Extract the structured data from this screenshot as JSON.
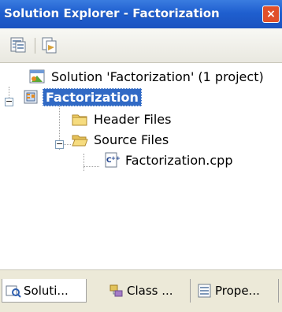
{
  "window": {
    "title": "Solution Explorer - Factorization"
  },
  "toolbar": {
    "buttons": [
      {
        "icon": "properties-icon"
      },
      {
        "icon": "show-all-files-icon"
      }
    ]
  },
  "tree": {
    "solution": "Solution 'Factorization' (1 project)",
    "project": "Factorization",
    "header_files": "Header Files",
    "source_files": "Source Files",
    "cpp_file": "Factorization.cpp",
    "expander_minus": "−"
  },
  "tabs": [
    {
      "label": "Soluti...",
      "icon": "solution-explorer-icon",
      "active": true
    },
    {
      "label": "Class ...",
      "icon": "class-view-icon",
      "active": false
    },
    {
      "label": "Prope...",
      "icon": "property-manager-icon",
      "active": false
    }
  ],
  "colors": {
    "title_bar": "#1f5fcf",
    "selection": "#316ac5",
    "tab_bar": "#ece9d8"
  }
}
